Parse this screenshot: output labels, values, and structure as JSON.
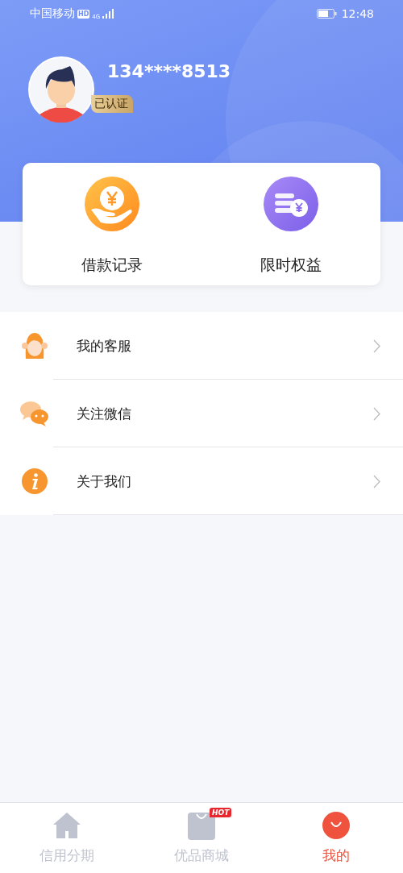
{
  "status_bar": {
    "carrier": "中国移动",
    "hd": "HD",
    "network": "4G",
    "time": "12:48"
  },
  "profile": {
    "phone": "134****8513",
    "verified": true,
    "badge": "已认证"
  },
  "quick_actions": [
    {
      "label": "借款记录"
    },
    {
      "label": "限时权益"
    }
  ],
  "menu": [
    {
      "label": "我的客服"
    },
    {
      "label": "关注微信"
    },
    {
      "label": "关于我们"
    }
  ],
  "tabs": [
    {
      "label": "信用分期",
      "selected": false
    },
    {
      "label": "优品商城",
      "selected": false,
      "badge": "HOT"
    },
    {
      "label": "我的",
      "selected": true
    }
  ]
}
